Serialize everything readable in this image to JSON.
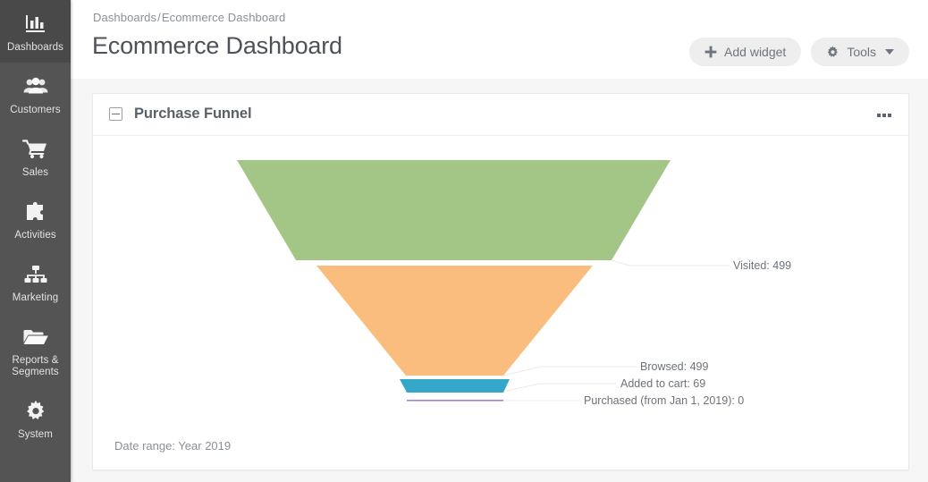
{
  "sidebar": {
    "items": [
      {
        "label": "Dashboards",
        "icon": "bar-chart-icon",
        "active": true
      },
      {
        "label": "Customers",
        "icon": "users-icon",
        "active": false
      },
      {
        "label": "Sales",
        "icon": "shopping-cart-icon",
        "active": false
      },
      {
        "label": "Activities",
        "icon": "puzzle-piece-icon",
        "active": false
      },
      {
        "label": "Marketing",
        "icon": "sitemap-icon",
        "active": false
      },
      {
        "label": "Reports & Segments",
        "icon": "folder-open-icon",
        "active": false
      },
      {
        "label": "System",
        "icon": "gear-icon",
        "active": false
      }
    ]
  },
  "header": {
    "breadcrumb_root": "Dashboards",
    "breadcrumb_separator": "/",
    "breadcrumb_current": "Ecommerce Dashboard",
    "title": "Ecommerce Dashboard",
    "add_widget_label": "Add widget",
    "tools_label": "Tools"
  },
  "widget": {
    "title": "Purchase Funnel",
    "date_range": "Date range: Year 2019"
  },
  "chart_data": {
    "type": "funnel",
    "title": "Purchase Funnel",
    "categories": [
      "Visited",
      "Browsed",
      "Added to cart",
      "Purchased (from Jan 1, 2019)"
    ],
    "values": [
      499,
      499,
      69,
      0
    ],
    "labels": [
      "Visited: 499",
      "Browsed: 499",
      "Added to cart: 69",
      "Purchased (from Jan 1, 2019): 0"
    ],
    "colors": [
      "#a3c585",
      "#fabd7e",
      "#35a8c9",
      "#ab80cd"
    ],
    "legend": "none",
    "grid": false,
    "date_range": "Year 2019"
  }
}
